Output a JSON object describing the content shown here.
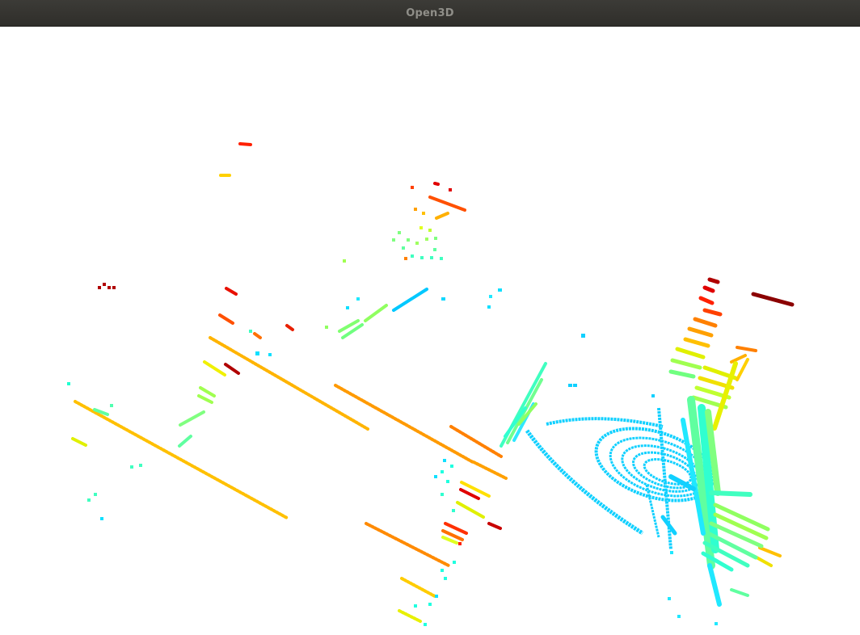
{
  "window": {
    "title": "Open3D"
  },
  "viewport": {
    "background": "#ffffff",
    "colormap": "jet"
  }
}
